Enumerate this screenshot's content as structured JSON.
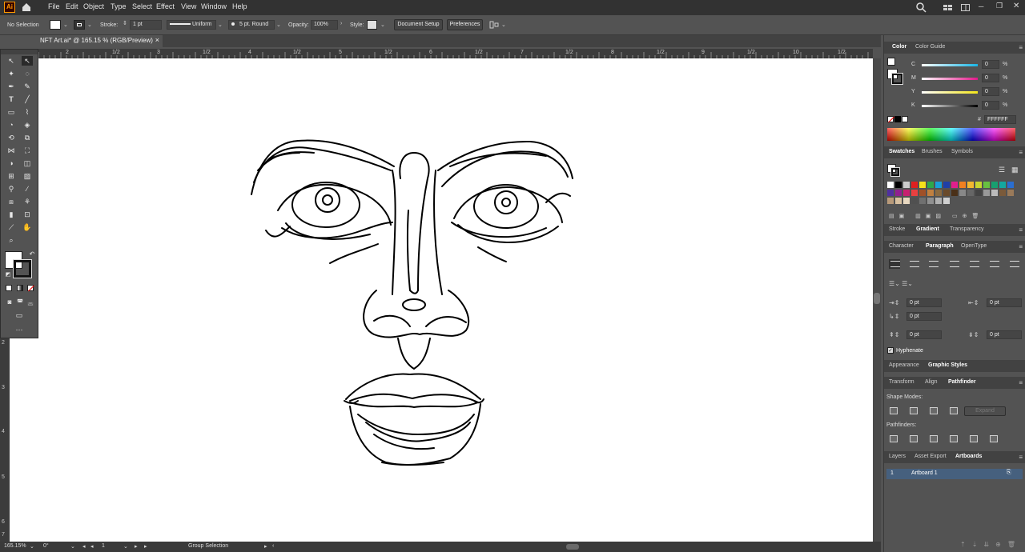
{
  "app": {
    "logo": "Ai"
  },
  "menu": [
    "File",
    "Edit",
    "Object",
    "Type",
    "Select",
    "Effect",
    "View",
    "Window",
    "Help"
  ],
  "control": {
    "selection": "No Selection",
    "stroke_label": "Stroke:",
    "stroke_value": "1 pt",
    "profile": "Uniform",
    "brush": "5 pt. Round",
    "opacity_label": "Opacity:",
    "opacity_value": "100%",
    "style_label": "Style:",
    "doc_setup": "Document Setup",
    "preferences": "Preferences"
  },
  "document": {
    "tab_title": "NFT Art.ai* @ 165.15 % (RGB/Preview)",
    "close": "×"
  },
  "ruler": {
    "h_marks": [
      "2",
      "1/2",
      "3",
      "1/2",
      "4",
      "1/2",
      "5",
      "1/2",
      "6",
      "1/2",
      "7",
      "1/2",
      "8",
      "1/2",
      "9",
      "1/2",
      "10",
      "1/2"
    ],
    "v_marks": [
      "2",
      "3",
      "4",
      "5",
      "6",
      "7"
    ]
  },
  "status": {
    "zoom": "165.15%",
    "rotation": "0°",
    "artboard": "1",
    "tool": "Group Selection"
  },
  "color_panel": {
    "tabs": [
      "Color",
      "Color Guide"
    ],
    "channels": [
      {
        "name": "C",
        "value": "0",
        "unit": "%",
        "color": "#19b5e5"
      },
      {
        "name": "M",
        "value": "0",
        "unit": "%",
        "color": "#e2188a"
      },
      {
        "name": "Y",
        "value": "0",
        "unit": "%",
        "color": "#f3e51a"
      },
      {
        "name": "K",
        "value": "0",
        "unit": "%",
        "color": "#cfcfcf"
      }
    ],
    "hex_symbol": "#",
    "hex": "FFFFFF"
  },
  "swatches_panel": {
    "tabs": [
      "Swatches",
      "Brushes",
      "Symbols"
    ]
  },
  "gradient_tabs": [
    "Stroke",
    "Gradient",
    "Transparency"
  ],
  "paragraph_panel": {
    "tabs": [
      "Character",
      "Paragraph",
      "OpenType"
    ],
    "indent_left": "0 pt",
    "indent_right": "0 pt",
    "indent_first": "0 pt",
    "space_before": "0 pt",
    "space_after": "0 pt",
    "hyphenate": "Hyphenate"
  },
  "appearance_tabs": [
    "Appearance",
    "Graphic Styles"
  ],
  "pathfinder_panel": {
    "tabs": [
      "Transform",
      "Align",
      "Pathfinder"
    ],
    "shape_modes": "Shape Modes:",
    "expand": "Expand",
    "pathfinders": "Pathfinders:"
  },
  "layers_panel": {
    "tabs": [
      "Layers",
      "Asset Export",
      "Artboards"
    ],
    "rows": [
      {
        "index": "1",
        "name": "Artboard 1"
      }
    ]
  },
  "colors": {
    "ui_bg": "#535353",
    "panel_dark": "#424242",
    "menu_bg": "#323232",
    "canvas": "#ffffff",
    "selected_row": "#46607e",
    "ai_logo": "#ff9a00"
  }
}
